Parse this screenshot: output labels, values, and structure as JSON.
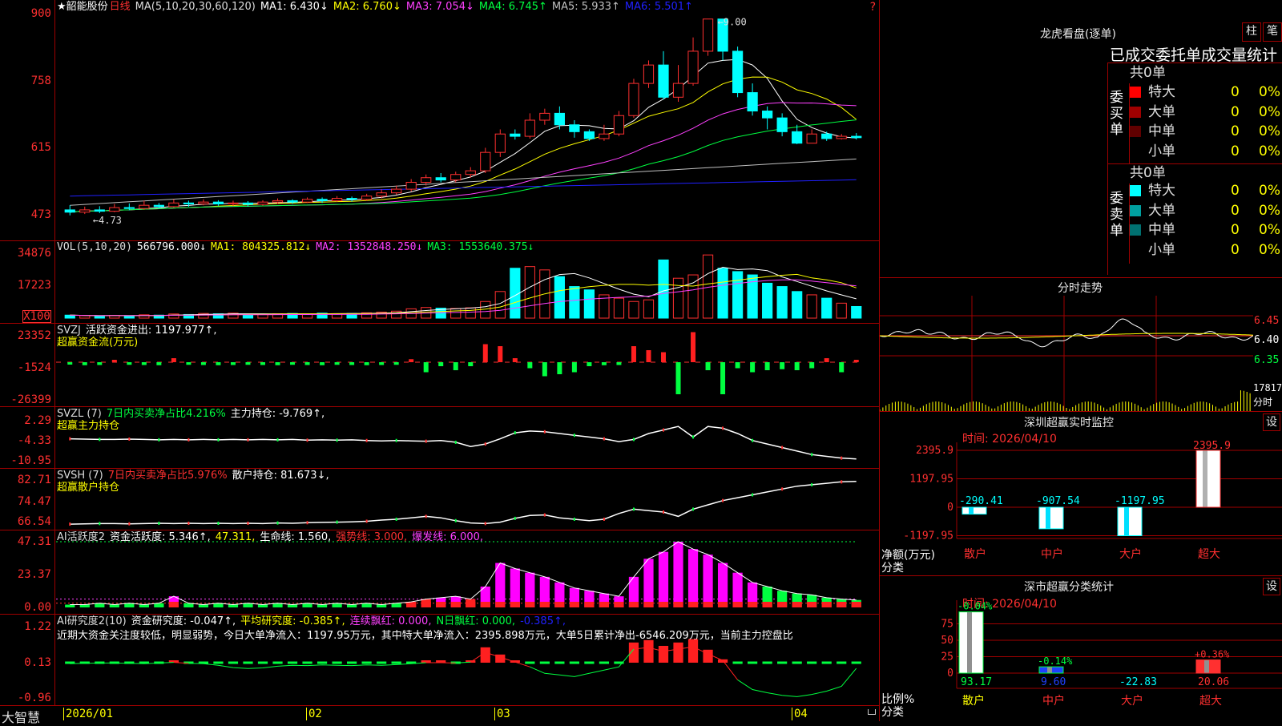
{
  "stock_title": "★韶能股份",
  "period": "日线",
  "corner_mark": "?",
  "main": {
    "y_labels": [
      "900",
      "758",
      "615",
      "473"
    ],
    "ma_title": "MA(5,10,20,30,60,120)",
    "ma_values": [
      {
        "label": "MA1: 6.430↓",
        "color": "#ffffff"
      },
      {
        "label": "MA2: 6.760↓",
        "color": "#ffff00"
      },
      {
        "label": "MA3: 7.054↓",
        "color": "#ff40ff"
      },
      {
        "label": "MA4: 6.745↑",
        "color": "#00ff40"
      },
      {
        "label": "MA5: 5.933↑",
        "color": "#c0c0c0"
      },
      {
        "label": "MA6: 5.501↑",
        "color": "#2020ff"
      }
    ],
    "high_label": "9.00",
    "low_label": "4.73"
  },
  "vol": {
    "y_labels": [
      "34876",
      "17223"
    ],
    "unit_label": "X100",
    "title": "VOL(5,10,20)",
    "values": [
      {
        "label": "566796.000↓",
        "color": "#ffffff"
      },
      {
        "label": "MA1: 804325.812↓",
        "color": "#ffff00"
      },
      {
        "label": "MA2: 1352848.250↓",
        "color": "#ff40ff"
      },
      {
        "label": "MA3: 1553640.375↓",
        "color": "#00ff40"
      }
    ]
  },
  "svzj": {
    "y_labels": [
      "23352",
      "-1524",
      "-26399"
    ],
    "title": "SVZJ",
    "value": "活跃资金进出: 1197.977↑,",
    "subtitle": "超赢资金流(万元)"
  },
  "svzl": {
    "y_labels": [
      "2.29",
      "-4.33",
      "-10.95"
    ],
    "title": "SVZL (7)",
    "ratio": "7日内买卖净占比4.216%",
    "value": "主力持仓: -9.769↑,",
    "subtitle": "超赢主力持仓"
  },
  "svsh": {
    "y_labels": [
      "82.71",
      "74.47",
      "66.54"
    ],
    "title": "SVSH (7)",
    "ratio": "7日内买卖净占比5.976%",
    "value": "散户持仓: 81.673↓,",
    "subtitle": "超赢散户持仓"
  },
  "ai1": {
    "y_labels": [
      "47.31",
      "23.37",
      "0.00"
    ],
    "title": "AI活跃度2",
    "values": [
      {
        "label": "资金活跃度: 5.346↑,",
        "color": "#ffffff"
      },
      {
        "label": "47.311,",
        "color": "#ffff00"
      },
      {
        "label": "生命线: 1.560,",
        "color": "#ffffff"
      },
      {
        "label": "强势线: 3.000,",
        "color": "#ff3030"
      },
      {
        "label": "爆发线: 6.000,",
        "color": "#ff40ff"
      }
    ]
  },
  "ai2": {
    "y_labels": [
      "1.22",
      "0.13",
      "-0.96"
    ],
    "title": "AI研究度2(10)",
    "values": [
      {
        "label": "资金研究度: -0.047↑,",
        "color": "#ffffff"
      },
      {
        "label": "平均研究度: -0.385↑,",
        "color": "#ffff00"
      },
      {
        "label": "连续飘红: 0.000,",
        "color": "#ff40ff"
      },
      {
        "label": "N日飘红: 0.000,",
        "color": "#00ff40"
      },
      {
        "label": "-0.385↑,",
        "color": "#2020ff"
      }
    ],
    "commentary": "近期大资金关注度较低，明显弱势，今日大单净流入：1197.95万元，其中特大单净流入：2395.898万元，大单5日累计净出-6546.209万元，当前主力控盘比"
  },
  "xaxis": {
    "brand": "大智慧",
    "dates": [
      "2026/01",
      "02",
      "03",
      "04"
    ]
  },
  "right": {
    "dragon_title": "龙虎看盘(逐单)",
    "btn_bar": "柱",
    "btn_pen": "笔",
    "order_stats_title": "已成交委托单成交量统计",
    "buy": {
      "total": "共0单",
      "side_label": "委买单",
      "rows": [
        {
          "label": "特大",
          "count": "0",
          "pct": "0%",
          "color": "#ff0000"
        },
        {
          "label": "大单",
          "count": "0",
          "pct": "0%",
          "color": "#a00000"
        },
        {
          "label": "中单",
          "count": "0",
          "pct": "0%",
          "color": "#600000"
        },
        {
          "label": "小单",
          "count": "0",
          "pct": "0%",
          "color": ""
        }
      ]
    },
    "sell": {
      "total": "共0单",
      "side_label": "委卖单",
      "rows": [
        {
          "label": "特大",
          "count": "0",
          "pct": "0%",
          "color": "#00ffff"
        },
        {
          "label": "大单",
          "count": "0",
          "pct": "0%",
          "color": "#00a0a0"
        },
        {
          "label": "中单",
          "count": "0",
          "pct": "0%",
          "color": "#007070"
        },
        {
          "label": "小单",
          "count": "0",
          "pct": "0%",
          "color": ""
        }
      ]
    },
    "intraday": {
      "title": "分时走势",
      "price_labels": [
        "6.45",
        "6.40",
        "6.35"
      ],
      "vol_label": "17817",
      "vol_unit": "分时"
    },
    "monitor": {
      "title": "深圳超赢实时监控",
      "setting": "设",
      "time": "时间: 2026/04/10",
      "y_labels": [
        "2395.9",
        "1197.95",
        "0",
        "-1197.95"
      ],
      "axis_name_1": "净额(万元)",
      "axis_name_2": "分类",
      "bars": [
        {
          "cat": "散户",
          "value": -290.41,
          "label": "-290.41"
        },
        {
          "cat": "中户",
          "value": -907.54,
          "label": "-907.54"
        },
        {
          "cat": "大户",
          "value": -1197.95,
          "label": "-1197.95"
        },
        {
          "cat": "超大",
          "value": 2395.9,
          "label": "2395.9"
        }
      ]
    },
    "classify": {
      "title": "深市超赢分类统计",
      "setting": "设",
      "time": "时间: 2026/04/10",
      "y_labels": [
        "75",
        "50",
        "25",
        "0"
      ],
      "axis_name_1": "比例%",
      "axis_name_2": "分类",
      "bars": [
        {
          "cat": "散户",
          "value": 93.17,
          "label": "93.17",
          "change": "-0.04%",
          "color": "#00ff40",
          "bar_color": "#ffffff",
          "cat_color": "#ffff00"
        },
        {
          "cat": "中户",
          "value": 9.6,
          "label": "9.60",
          "change": "-0.14%",
          "color": "#00ff40",
          "bar_color": "#2040ff",
          "cat_color": "#ff3030"
        },
        {
          "cat": "大户",
          "value": -22.83,
          "label": "-22.83",
          "change": "",
          "color": "#00ffff",
          "bar_color": "#00ffff",
          "cat_color": "#ff3030"
        },
        {
          "cat": "超大",
          "value": 20.06,
          "label": "20.06",
          "change": "+0.36%",
          "color": "#ff3030",
          "bar_color": "#ff3030",
          "cat_color": "#ff3030"
        }
      ]
    }
  },
  "chart_data": [
    {
      "type": "candlestick",
      "title": "★韶能股份 日线",
      "ylim": [
        4.5,
        9.1
      ],
      "candles": [
        [
          4.85,
          4.8,
          4.95,
          4.73
        ],
        [
          4.8,
          4.85,
          4.92,
          4.76
        ],
        [
          4.85,
          4.82,
          4.93,
          4.78
        ],
        [
          4.82,
          4.9,
          4.98,
          4.8
        ],
        [
          4.9,
          4.88,
          4.99,
          4.84
        ],
        [
          4.88,
          4.95,
          5.05,
          4.85
        ],
        [
          4.95,
          4.92,
          5.0,
          4.88
        ],
        [
          4.92,
          5.0,
          5.08,
          4.9
        ],
        [
          5.0,
          4.98,
          5.05,
          4.92
        ],
        [
          4.98,
          5.02,
          5.08,
          4.95
        ],
        [
          5.02,
          4.98,
          5.06,
          4.94
        ],
        [
          4.98,
          5.0,
          5.05,
          4.93
        ],
        [
          5.0,
          4.97,
          5.04,
          4.92
        ],
        [
          4.97,
          5.02,
          5.06,
          4.94
        ],
        [
          5.02,
          5.05,
          5.1,
          4.98
        ],
        [
          5.05,
          5.02,
          5.08,
          4.98
        ],
        [
          5.02,
          5.08,
          5.12,
          5.0
        ],
        [
          5.08,
          5.05,
          5.12,
          5.0
        ],
        [
          5.05,
          5.1,
          5.15,
          5.02
        ],
        [
          5.1,
          5.08,
          5.14,
          5.03
        ],
        [
          5.08,
          5.15,
          5.2,
          5.05
        ],
        [
          5.15,
          5.22,
          5.3,
          5.1
        ],
        [
          5.22,
          5.3,
          5.38,
          5.18
        ],
        [
          5.3,
          5.45,
          5.52,
          5.25
        ],
        [
          5.45,
          5.55,
          5.62,
          5.38
        ],
        [
          5.55,
          5.5,
          5.65,
          5.45
        ],
        [
          5.5,
          5.62,
          5.68,
          5.45
        ],
        [
          5.62,
          5.7,
          5.78,
          5.55
        ],
        [
          5.7,
          6.1,
          6.2,
          5.65
        ],
        [
          6.1,
          6.5,
          6.6,
          6.0
        ],
        [
          6.5,
          6.45,
          6.6,
          6.38
        ],
        [
          6.45,
          6.8,
          6.95,
          6.4
        ],
        [
          6.8,
          6.95,
          7.05,
          6.7
        ],
        [
          6.95,
          6.7,
          7.1,
          6.6
        ],
        [
          6.7,
          6.55,
          6.8,
          6.42
        ],
        [
          6.55,
          6.4,
          6.6,
          6.35
        ],
        [
          6.4,
          6.5,
          6.7,
          6.35
        ],
        [
          6.5,
          6.9,
          7.0,
          6.45
        ],
        [
          6.9,
          7.6,
          7.7,
          6.85
        ],
        [
          7.6,
          8.0,
          8.1,
          7.5
        ],
        [
          8.0,
          7.3,
          8.3,
          7.25
        ],
        [
          7.3,
          7.6,
          8.0,
          7.2
        ],
        [
          7.6,
          8.3,
          8.6,
          7.55
        ],
        [
          8.3,
          9.0,
          9.0,
          8.2
        ],
        [
          9.0,
          8.3,
          9.0,
          8.1
        ],
        [
          8.3,
          7.4,
          8.4,
          7.3
        ],
        [
          7.4,
          7.0,
          7.6,
          6.9
        ],
        [
          7.0,
          6.85,
          7.1,
          6.6
        ],
        [
          6.85,
          6.55,
          6.95,
          6.45
        ],
        [
          6.55,
          6.3,
          6.7,
          6.28
        ],
        [
          6.3,
          6.5,
          6.6,
          6.3
        ],
        [
          6.5,
          6.4,
          6.55,
          6.35
        ],
        [
          6.4,
          6.45,
          6.5,
          6.38
        ],
        [
          6.45,
          6.42,
          6.52,
          6.38
        ]
      ]
    },
    {
      "type": "bar",
      "title": "VOL(5,10,20)",
      "ylim": [
        0,
        40000
      ],
      "values": [
        1800,
        1500,
        1200,
        1600,
        1400,
        2000,
        1800,
        2500,
        2200,
        2800,
        2600,
        3000,
        2400,
        2200,
        2600,
        2800,
        2500,
        3000,
        2600,
        2800,
        3200,
        3600,
        4200,
        5600,
        6400,
        6000,
        5800,
        6200,
        10000,
        16000,
        30000,
        31000,
        29000,
        25000,
        19000,
        17000,
        14000,
        12000,
        10000,
        11000,
        35000,
        24000,
        26000,
        38000,
        30000,
        28000,
        26000,
        21000,
        19000,
        16000,
        14000,
        12000,
        9000,
        7000
      ]
    },
    {
      "type": "bar",
      "title": "SVZJ 活跃资金进出",
      "values": [
        -1200,
        -1500,
        -1400,
        1200,
        -1300,
        -1400,
        -1500,
        2000,
        -1300,
        -1400,
        -1500,
        -1400,
        -1300,
        -1400,
        -1500,
        -1300,
        -1400,
        -1500,
        -1300,
        -1400,
        -1500,
        -1400,
        -1300,
        1500,
        -5000,
        -2000,
        -4000,
        -2000,
        9000,
        8000,
        2000,
        -3000,
        -7000,
        -6000,
        -5000,
        -2000,
        -1500,
        -1400,
        8000,
        6000,
        5000,
        -16000,
        15000,
        -4000,
        -16000,
        -3000,
        -5000,
        -4000,
        -3500,
        -4000,
        -3000,
        2000,
        -5000,
        1197.977
      ]
    },
    {
      "type": "line",
      "title": "SVZL 主力持仓",
      "values": [
        -4.0,
        -4.1,
        -4.2,
        -4.2,
        -4.1,
        -4.2,
        -4.3,
        -4.2,
        -4.3,
        -4.2,
        -4.3,
        -4.2,
        -4.3,
        -4.2,
        -4.3,
        -4.2,
        -4.4,
        -4.3,
        -4.4,
        -4.3,
        -4.5,
        -4.6,
        -4.5,
        -4.6,
        -4.7,
        -4.5,
        -5.0,
        -6.2,
        -5.5,
        -4.0,
        -2.3,
        -1.8,
        -2.0,
        -2.5,
        -3.0,
        -3.5,
        -4.0,
        -4.8,
        -4.2,
        -2.5,
        -1.5,
        -0.5,
        -3.5,
        -0.5,
        -1.0,
        -2.5,
        -4.5,
        -5.5,
        -6.5,
        -7.5,
        -8.5,
        -9.0,
        -9.5,
        -9.769
      ]
    },
    {
      "type": "line",
      "title": "SVSH 散户持仓",
      "values": [
        66.8,
        66.9,
        67.0,
        67.0,
        66.9,
        67.0,
        67.1,
        67.0,
        67.1,
        67.0,
        67.1,
        67.0,
        67.1,
        67.0,
        67.2,
        67.1,
        67.3,
        67.4,
        67.5,
        67.6,
        67.8,
        68.2,
        68.5,
        69.0,
        69.5,
        69.0,
        68.0,
        67.2,
        67.0,
        67.5,
        68.8,
        69.8,
        70.0,
        69.0,
        68.5,
        68.0,
        68.5,
        70.5,
        72.0,
        71.5,
        71.0,
        69.5,
        72.0,
        73.5,
        75.0,
        76.0,
        77.0,
        78.0,
        79.0,
        80.0,
        80.5,
        81.0,
        81.5,
        81.673
      ]
    },
    {
      "type": "bar",
      "title": "AI活跃度2 资金活跃度",
      "ylim": [
        0,
        47.311
      ],
      "values": [
        2,
        2,
        3,
        2,
        3,
        2,
        3,
        8,
        3,
        2,
        3,
        2,
        3,
        2,
        3,
        2,
        3,
        2,
        3,
        2,
        3,
        2,
        3,
        4,
        6,
        7,
        8,
        6,
        15,
        32,
        28,
        25,
        22,
        18,
        14,
        12,
        10,
        8,
        22,
        35,
        40,
        47.3,
        42,
        38,
        32,
        25,
        18,
        15,
        12,
        10,
        9,
        7,
        6,
        5.346
      ]
    },
    {
      "type": "line",
      "title": "AI研究度2(10) 资金研究度",
      "ylim": [
        -0.96,
        1.22
      ],
      "values": [
        0.1,
        0.11,
        0.12,
        0.12,
        0.11,
        0.1,
        0.12,
        0.14,
        0.11,
        0.1,
        0.05,
        -0.02,
        -0.05,
        -0.03,
        0.02,
        0.05,
        0.04,
        0.06,
        0.05,
        0.04,
        0.06,
        0.05,
        0.07,
        0.1,
        0.13,
        0.13,
        0.12,
        0.15,
        0.45,
        0.3,
        0.15,
        0.0,
        -0.2,
        -0.25,
        -0.3,
        -0.2,
        -0.1,
        0.0,
        0.55,
        0.6,
        0.48,
        0.55,
        0.62,
        0.4,
        0.2,
        -0.4,
        -0.7,
        -0.8,
        -0.88,
        -0.92,
        -0.85,
        -0.75,
        -0.6,
        -0.047
      ]
    }
  ]
}
